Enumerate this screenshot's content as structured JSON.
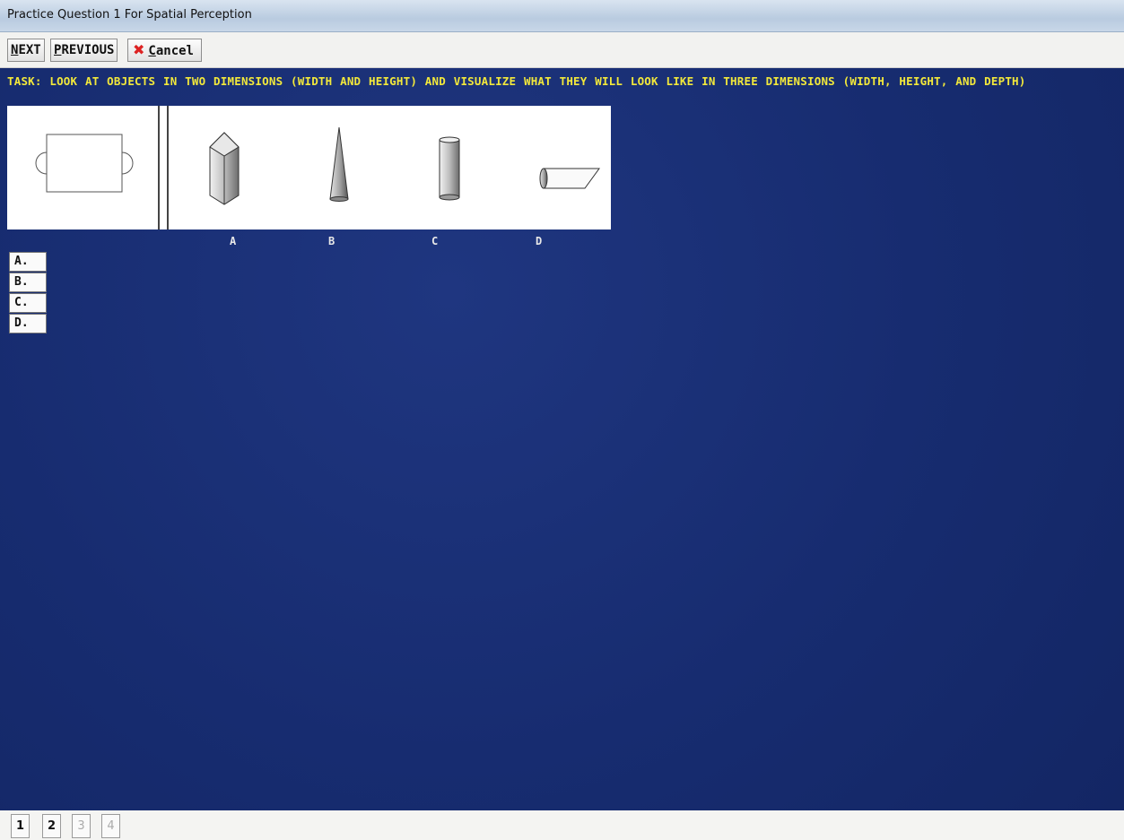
{
  "window": {
    "title": "Practice Question 1 For Spatial Perception"
  },
  "toolbar": {
    "next_label_u": "N",
    "next_label_rest": "EXT",
    "previous_label_u": "P",
    "previous_label_rest": "REVIOUS",
    "cancel_label_u": "C",
    "cancel_label_rest": "ancel"
  },
  "task": {
    "text": "TASK:  LOOK AT OBJECTS IN TWO DIMENSIONS (WIDTH AND HEIGHT) AND VISUALIZE WHAT THEY WILL LOOK LIKE IN THREE DIMENSIONS (WIDTH, HEIGHT, AND DEPTH)"
  },
  "choices": {
    "letters": [
      "A",
      "B",
      "C",
      "D"
    ],
    "shapes": [
      "hexagonal-prism",
      "cone",
      "cylinder",
      "slanted-cylinder"
    ]
  },
  "answers": [
    "A.",
    "B.",
    "C.",
    "D."
  ],
  "pages": [
    "1",
    "2",
    "3",
    "4"
  ],
  "colors": {
    "background": "#172c70",
    "task_text": "#f2e83b",
    "cancel_icon": "#d22222"
  }
}
